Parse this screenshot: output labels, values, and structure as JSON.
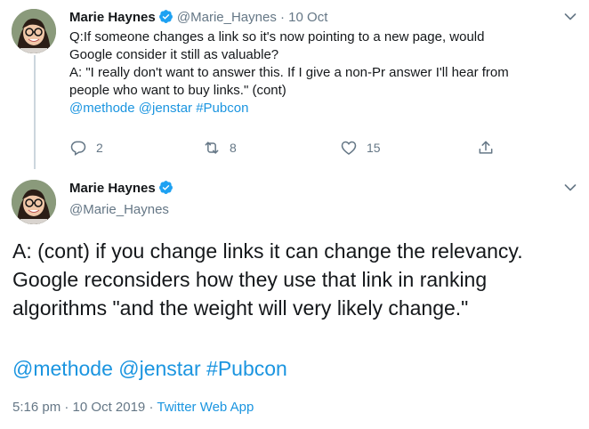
{
  "tweet1": {
    "name": "Marie Haynes",
    "handle": "@Marie_Haynes",
    "separator": "·",
    "date": "10 Oct",
    "body_lines": [
      "Q:If someone changes a link so it's now pointing to a new page, would",
      "Google consider it still as valuable?",
      "A: \"I really don't want to answer this. If I give a non-Pr answer I'll hear from",
      "people who want to buy links.\" (cont)"
    ],
    "mentions": [
      "@methode",
      "@jenstar",
      "#Pubcon"
    ],
    "reply_count": "2",
    "retweet_count": "8",
    "like_count": "15"
  },
  "tweet2": {
    "name": "Marie Haynes",
    "handle": "@Marie_Haynes",
    "body_lines": [
      "A: (cont) if you change links it can change the relevancy.",
      "Google reconsiders how they use that link in ranking",
      "algorithms \"and the weight will very likely change.\""
    ],
    "mentions": [
      "@methode",
      "@jenstar",
      "#Pubcon"
    ],
    "time": "5:16 pm",
    "separator": "·",
    "date": "10 Oct 2019",
    "source": "Twitter Web App"
  },
  "icons": {
    "verified": "verified-badge-icon",
    "chevron": "chevron-down-icon",
    "reply": "reply-icon",
    "retweet": "retweet-icon",
    "like": "heart-icon",
    "share": "share-icon"
  },
  "colors": {
    "link": "#1b95e0",
    "muted": "#657786",
    "text": "#14171a",
    "verified": "#1da1f2"
  }
}
